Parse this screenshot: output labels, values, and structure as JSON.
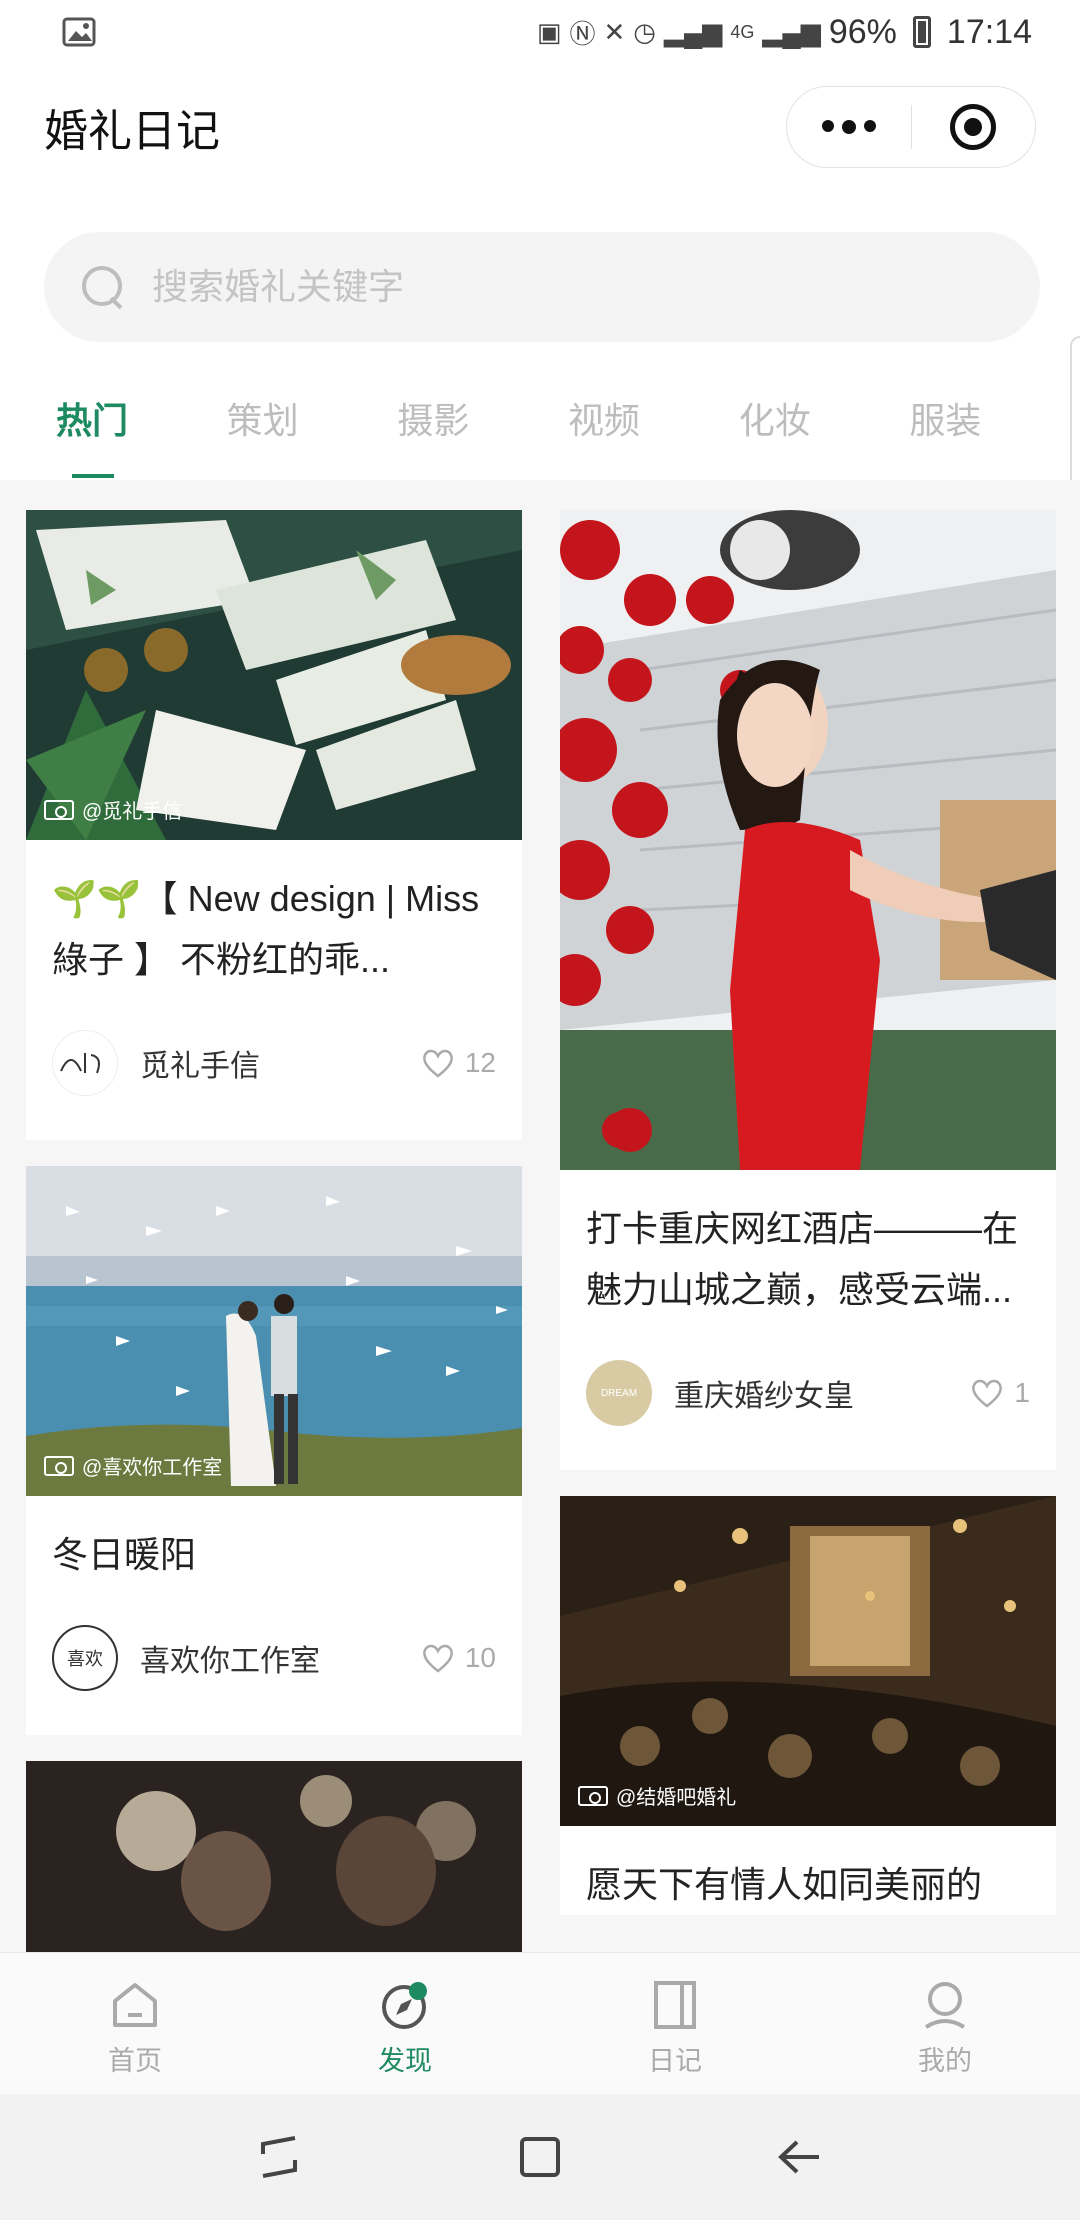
{
  "status_bar": {
    "battery": "96%",
    "time": "17:14",
    "network": "4G"
  },
  "header": {
    "title": "婚礼日记"
  },
  "search": {
    "placeholder": "搜索婚礼关键字"
  },
  "tabs": [
    {
      "label": "热门",
      "active": true
    },
    {
      "label": "策划",
      "active": false
    },
    {
      "label": "摄影",
      "active": false
    },
    {
      "label": "视频",
      "active": false
    },
    {
      "label": "化妆",
      "active": false
    },
    {
      "label": "服装",
      "active": false
    }
  ],
  "feed": {
    "left": [
      {
        "watermark": "@觅礼手信",
        "title": "🌱🌱【 New design | Miss 綠子 】 不粉红的乖...",
        "author": "觅礼手信",
        "likes": "12",
        "avatar_text": "觅礼"
      },
      {
        "watermark": "@喜欢你工作室",
        "title": "冬日暖阳",
        "author": "喜欢你工作室",
        "likes": "10",
        "avatar_text": "喜欢"
      },
      {
        "watermark": "",
        "title": "",
        "author": "",
        "likes": ""
      }
    ],
    "right": [
      {
        "watermark": "",
        "title": "打卡重庆网红酒店———在魅力山城之巅，感受云端...",
        "author": "重庆婚纱女皇",
        "likes": "1",
        "avatar_text": "DREAM"
      },
      {
        "watermark": "@结婚吧婚礼",
        "title": "愿天下有情人如同美丽的",
        "author": "",
        "likes": ""
      }
    ]
  },
  "tabbar": [
    {
      "label": "首页",
      "icon": "home-icon",
      "active": false
    },
    {
      "label": "发现",
      "icon": "compass-icon",
      "active": true
    },
    {
      "label": "日记",
      "icon": "diary-icon",
      "active": false
    },
    {
      "label": "我的",
      "icon": "profile-icon",
      "active": false
    }
  ],
  "colors": {
    "accent": "#1e8a62",
    "inactive": "#aaaaaa"
  }
}
